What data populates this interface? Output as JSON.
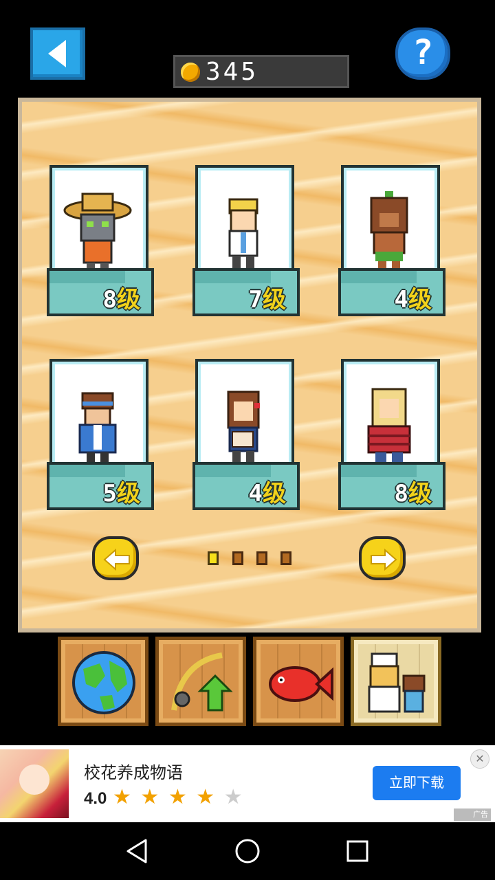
{
  "header": {
    "back_icon": "back-arrow-icon",
    "help_label": "?",
    "coins": "345",
    "coin_icon": "gold-coin-icon"
  },
  "cards": [
    {
      "id": "straw-hat-cat",
      "level": "8",
      "level_suffix": "级"
    },
    {
      "id": "blonde-boy",
      "level": "7",
      "level_suffix": "级"
    },
    {
      "id": "islander",
      "level": "4",
      "level_suffix": "级"
    },
    {
      "id": "headband-man",
      "level": "5",
      "level_suffix": "级"
    },
    {
      "id": "mother-with-baby",
      "level": "4",
      "level_suffix": "级"
    },
    {
      "id": "blonde-lumberjack",
      "level": "8",
      "level_suffix": "级"
    }
  ],
  "paging": {
    "current_page": 1,
    "total_pages": 4
  },
  "tabs": [
    {
      "icon": "globe-icon"
    },
    {
      "icon": "fishing-rod-upgrade-icon"
    },
    {
      "icon": "red-fish-icon"
    },
    {
      "icon": "crew-icon",
      "active": true
    }
  ],
  "ad": {
    "title": "校花养成物语",
    "rating": "4.0",
    "stars_on": "★ ★ ★ ★",
    "stars_off": "★",
    "cta": "立即下载",
    "label": "广告",
    "close": "✕"
  },
  "colors": {
    "accent_blue": "#2aa6e8",
    "gold": "#f3a900",
    "sand": "#f6cf8e",
    "ad_button": "#1c7cf0"
  }
}
